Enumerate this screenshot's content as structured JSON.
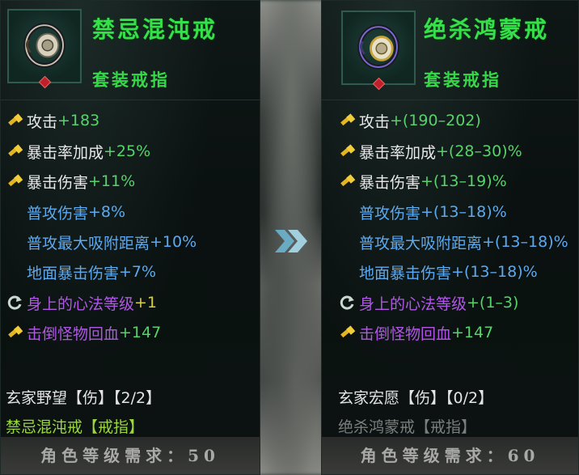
{
  "colors": {
    "title_green": "#36e04a",
    "stat_white": "#e9e9e9",
    "value_green": "#58d26a",
    "blue_stat": "#5ca9ef",
    "purple_stat": "#b057e6",
    "set_active": "#9bd83e",
    "set_inactive": "#7b7f7d",
    "requirement_gray": "#a9a9a6"
  },
  "left": {
    "title": "禁忌混沌戒",
    "subtitle": "套装戒指",
    "icon": "ring-icon",
    "stats": [
      {
        "icon": "hammer-icon",
        "name": "攻击",
        "value": "+183"
      },
      {
        "icon": "hammer-icon",
        "name": "暴击率加成",
        "value": "+25%"
      },
      {
        "icon": "hammer-icon",
        "name": "暴击伤害",
        "value": "+11%"
      },
      {
        "icon": "",
        "name": "普攻伤害",
        "value": "+8%"
      },
      {
        "icon": "",
        "name": "普攻最大吸附距离",
        "value": "+10%"
      },
      {
        "icon": "",
        "name": "地面暴击伤害",
        "value": "+7%"
      },
      {
        "icon": "refresh-icon",
        "name": "身上的心法等级",
        "value": "+1"
      },
      {
        "icon": "hammer-icon",
        "name": "击倒怪物回血",
        "value": "+147"
      }
    ],
    "set_name": "玄家野望【伤】【2/2】",
    "set_item": "禁忌混沌戒【戒指】",
    "requirement": "角色等级需求：50"
  },
  "right": {
    "title": "绝杀鸿蒙戒",
    "subtitle": "套装戒指",
    "icon": "ring-icon",
    "stats": [
      {
        "icon": "hammer-icon",
        "name": "攻击",
        "value": "+(190–202)"
      },
      {
        "icon": "hammer-icon",
        "name": "暴击率加成",
        "value": "+(28–30)%"
      },
      {
        "icon": "hammer-icon",
        "name": "暴击伤害",
        "value": "+(13–19)%"
      },
      {
        "icon": "",
        "name": "普攻伤害",
        "value": "+(13–18)%"
      },
      {
        "icon": "",
        "name": "普攻最大吸附距离",
        "value": "+(13–18)%"
      },
      {
        "icon": "",
        "name": "地面暴击伤害",
        "value": "+(13–18)%"
      },
      {
        "icon": "refresh-icon",
        "name": "身上的心法等级",
        "value": "+(1–3)"
      },
      {
        "icon": "hammer-icon",
        "name": "击倒怪物回血",
        "value": "+147"
      }
    ],
    "set_name": "玄家宏愿【伤】【0/2】",
    "set_item": "绝杀鸿蒙戒【戒指】",
    "requirement": "角色等级需求：60"
  },
  "compare_icon": "double-chevron-right-icon"
}
